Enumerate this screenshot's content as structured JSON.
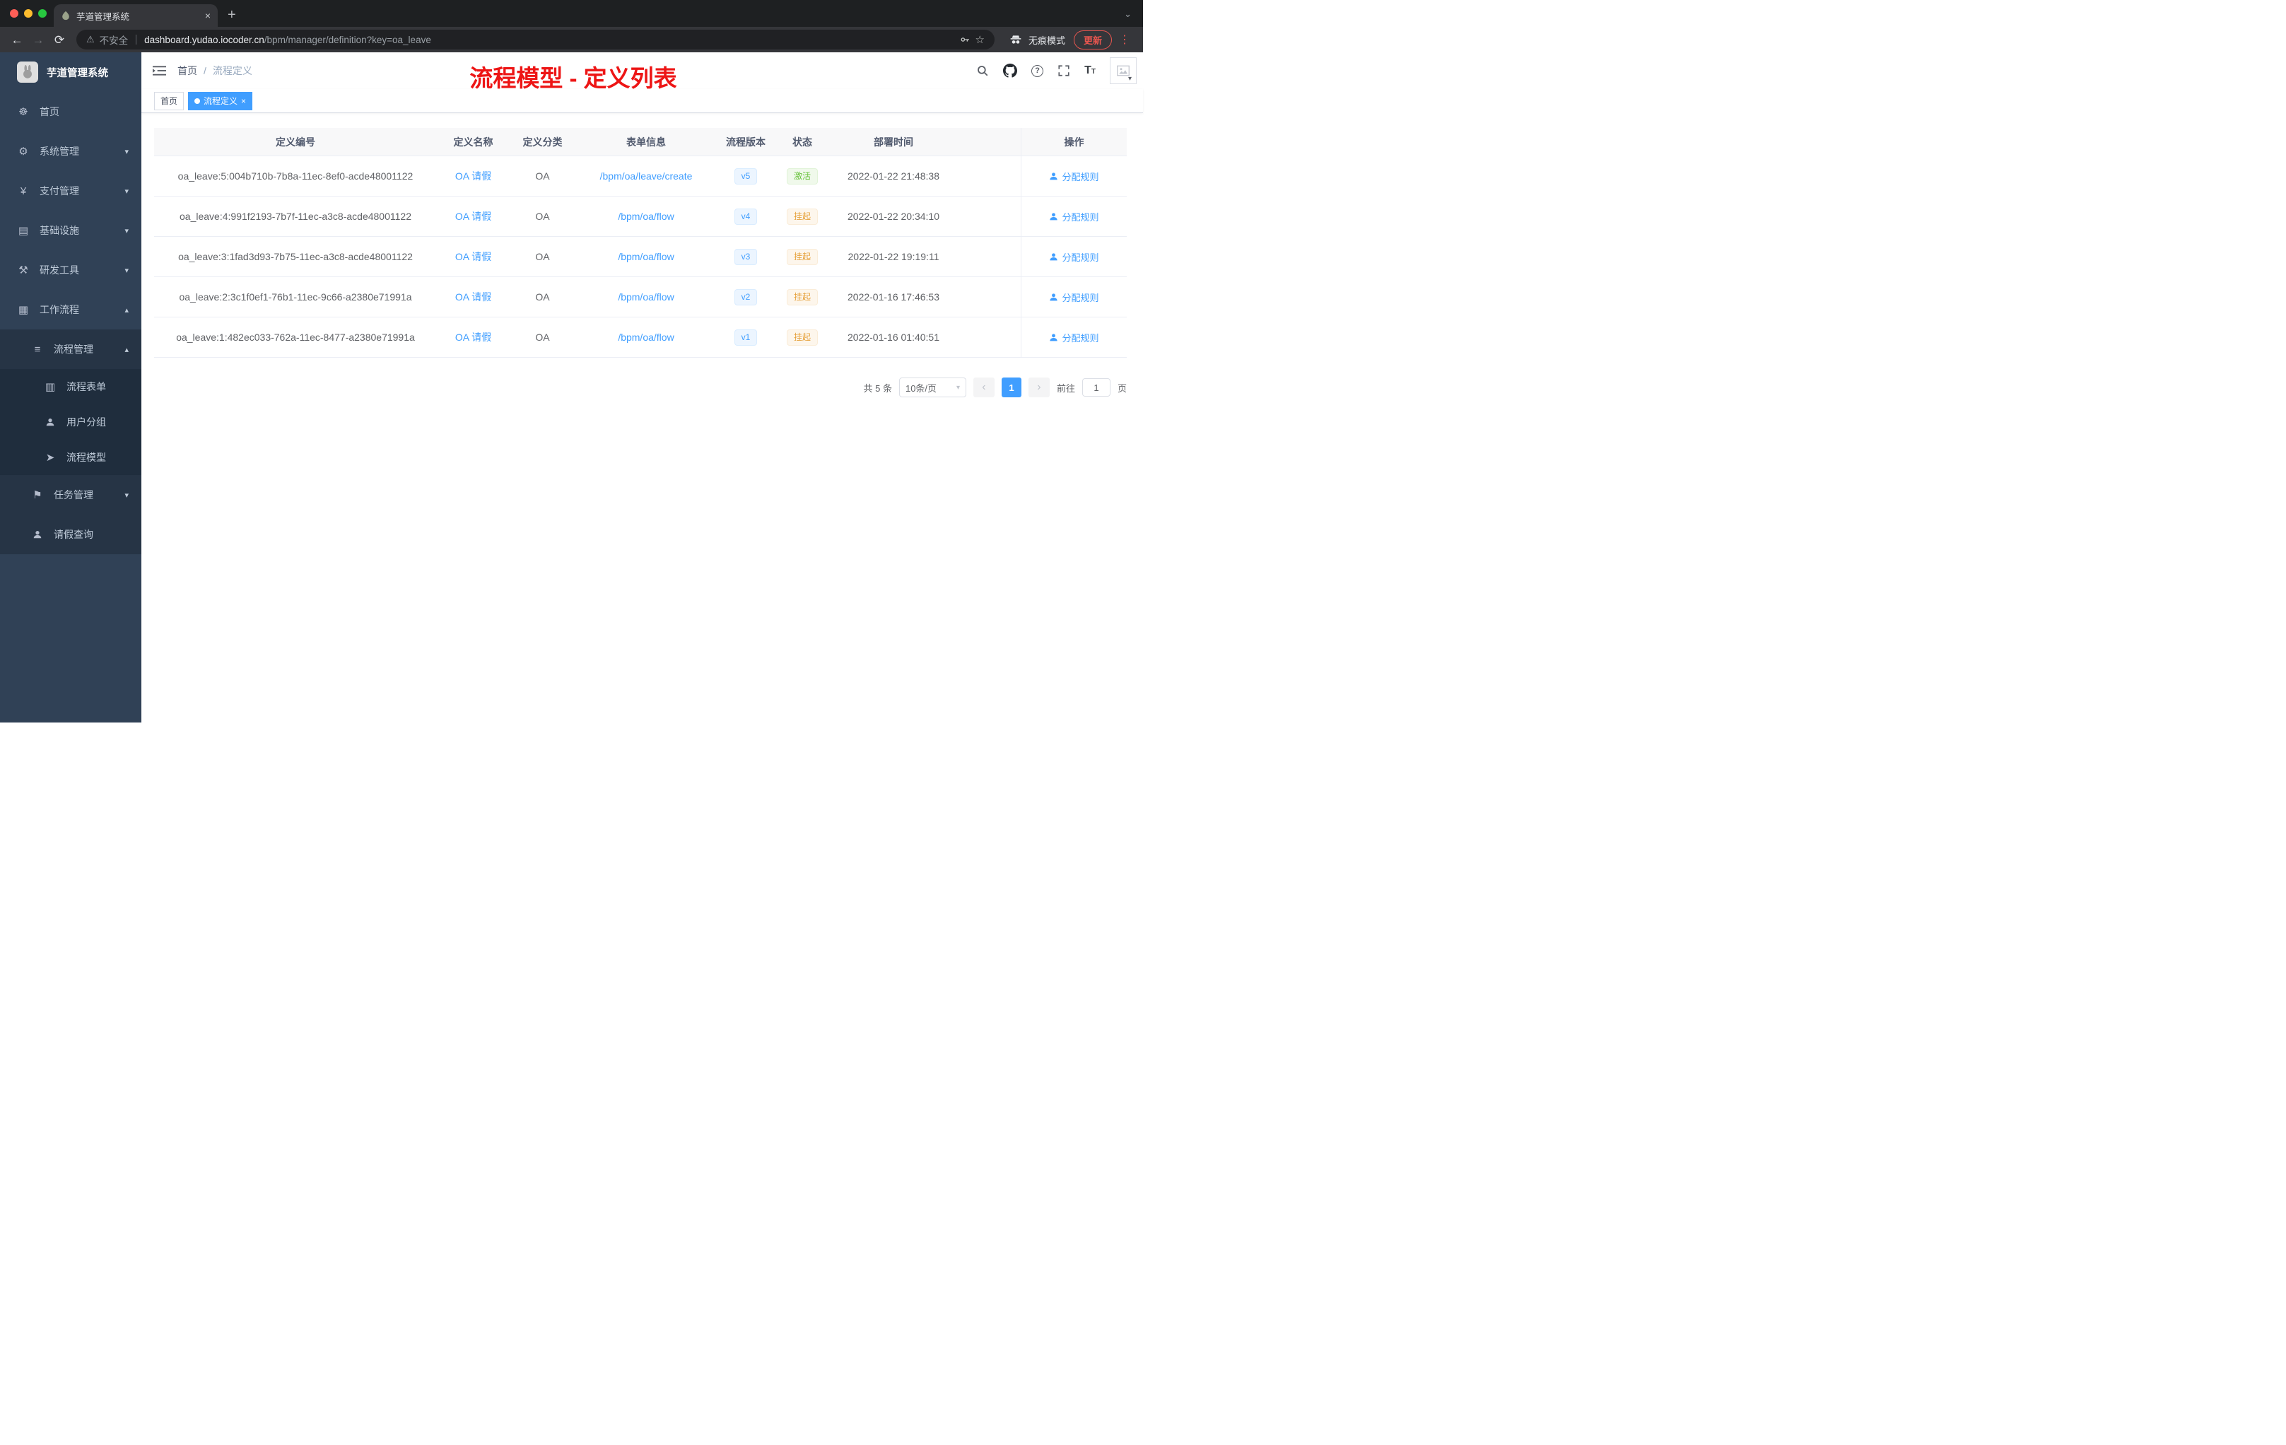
{
  "browser": {
    "tab_title": "芋道管理系统",
    "security_label": "不安全",
    "url_host": "dashboard.yudao.iocoder.cn",
    "url_path": "/bpm/manager/definition?key=oa_leave",
    "incognito_label": "无痕模式",
    "update_label": "更新"
  },
  "sidebar": {
    "logo_title": "芋道管理系统",
    "home": "首页",
    "system": "系统管理",
    "payment": "支付管理",
    "infra": "基础设施",
    "devtools": "研发工具",
    "workflow": "工作流程",
    "process_mgmt": "流程管理",
    "process_form": "流程表单",
    "user_group": "用户分组",
    "process_model": "流程模型",
    "task_mgmt": "任务管理",
    "leave_query": "请假查询"
  },
  "header": {
    "breadcrumb_home": "首页",
    "breadcrumb_sep": "/",
    "breadcrumb_current": "流程定义",
    "annotation": "流程模型 - 定义列表"
  },
  "tags": {
    "home": "首页",
    "active": "流程定义"
  },
  "table": {
    "columns": {
      "id": "定义编号",
      "name": "定义名称",
      "category": "定义分类",
      "form": "表单信息",
      "version": "流程版本",
      "status": "状态",
      "deploy_time": "部署时间",
      "actions": "操作"
    },
    "rows": [
      {
        "id": "oa_leave:5:004b710b-7b8a-11ec-8ef0-acde48001122",
        "name": "OA 请假",
        "category": "OA",
        "form": "/bpm/oa/leave/create",
        "version": "v5",
        "status": "激活",
        "status_type": "success",
        "deploy_time": "2022-01-22 21:48:38",
        "action": "分配规则"
      },
      {
        "id": "oa_leave:4:991f2193-7b7f-11ec-a3c8-acde48001122",
        "name": "OA 请假",
        "category": "OA",
        "form": "/bpm/oa/flow",
        "version": "v4",
        "status": "挂起",
        "status_type": "warning",
        "deploy_time": "2022-01-22 20:34:10",
        "action": "分配规则"
      },
      {
        "id": "oa_leave:3:1fad3d93-7b75-11ec-a3c8-acde48001122",
        "name": "OA 请假",
        "category": "OA",
        "form": "/bpm/oa/flow",
        "version": "v3",
        "status": "挂起",
        "status_type": "warning",
        "deploy_time": "2022-01-22 19:19:11",
        "action": "分配规则"
      },
      {
        "id": "oa_leave:2:3c1f0ef1-76b1-11ec-9c66-a2380e71991a",
        "name": "OA 请假",
        "category": "OA",
        "form": "/bpm/oa/flow",
        "version": "v2",
        "status": "挂起",
        "status_type": "warning",
        "deploy_time": "2022-01-16 17:46:53",
        "action": "分配规则"
      },
      {
        "id": "oa_leave:1:482ec033-762a-11ec-8477-a2380e71991a",
        "name": "OA 请假",
        "category": "OA",
        "form": "/bpm/oa/flow",
        "version": "v1",
        "status": "挂起",
        "status_type": "warning",
        "deploy_time": "2022-01-16 01:40:51",
        "action": "分配规则"
      }
    ]
  },
  "pagination": {
    "total": "共 5 条",
    "page_size": "10条/页",
    "page": "1",
    "goto_label": "前往",
    "goto_value": "1",
    "page_unit": "页"
  },
  "colors": {
    "accent_blue": "#409eff",
    "success_green": "#67c23a",
    "warning_orange": "#e6a23c",
    "annotation_red": "#ed1515",
    "sidebar_bg": "#304156"
  }
}
